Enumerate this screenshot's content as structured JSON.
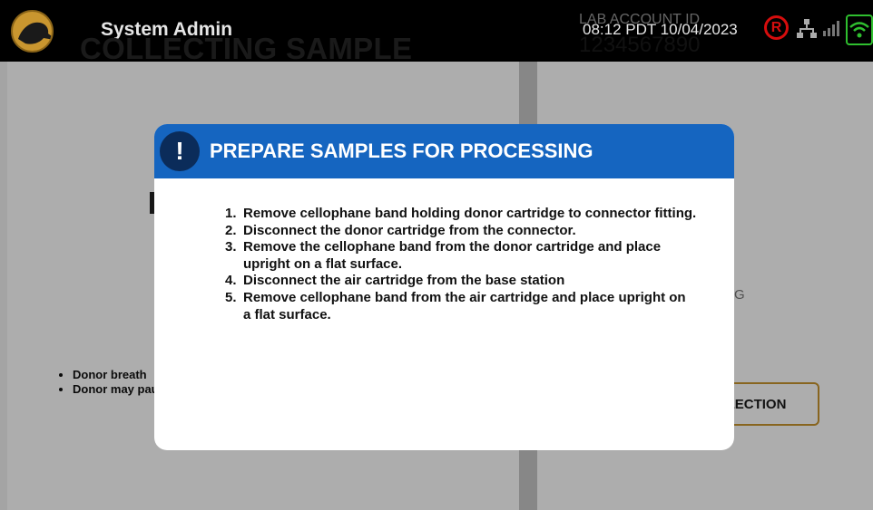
{
  "topbar": {
    "user_title": "System Admin",
    "datetime": "08:12 PDT  10/04/2023",
    "status_letter": "R",
    "colors": {
      "brand": "#c9962f",
      "alert": "#d60d0d",
      "wifi": "#2fbf2f"
    },
    "icons": [
      "dog-logo-icon",
      "registered-status-icon",
      "network-icon",
      "signal-icon",
      "wifi-icon"
    ]
  },
  "screen": {
    "title": "COLLECTING SAMPLE",
    "lab_account_label": "LAB ACCOUNT ID",
    "lab_account_value": "1234567890",
    "side_fragment": "G",
    "bullets": [
      "Donor breath",
      "Donor may pause to inhale"
    ],
    "cancel_label": "CANCEL COLLECTION"
  },
  "modal": {
    "title": "PREPARE SAMPLES FOR PROCESSING",
    "icon_glyph": "!",
    "header_color": "#1565c0",
    "steps": [
      {
        "num": "1.",
        "text": "Remove cellophane band holding donor cartridge to connector fitting."
      },
      {
        "num": "2.",
        "text": "Disconnect the donor cartridge from the connector."
      },
      {
        "num": "3.",
        "text": "Remove the cellophane band from the donor cartridge and place upright on a flat surface."
      },
      {
        "num": "4.",
        "text": "Disconnect the air cartridge from the base station"
      },
      {
        "num": "5.",
        "text": "Remove cellophane band from the air cartridge and place upright on a flat surface."
      }
    ]
  }
}
